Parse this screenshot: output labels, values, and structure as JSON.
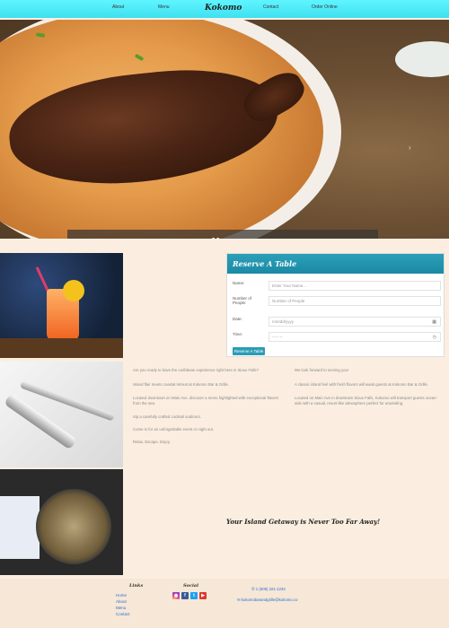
{
  "nav": {
    "about": "About",
    "menu": "Menu",
    "logo": "Kokomo",
    "contact": "Contact",
    "order": "Order Online"
  },
  "hero": {
    "caption": "Menu",
    "next_icon": "chevron-right-icon"
  },
  "reserve": {
    "title": "Reserve A Table",
    "name_label": "Name:",
    "name_placeholder": "Enter Your Name...",
    "people_label": "Number of People:",
    "people_placeholder": "Number of People",
    "date_label": "Date:",
    "date_placeholder": "mm/dd/yyyy",
    "time_label": "Time:",
    "time_placeholder": "--:-- --",
    "button": "Reserve A Table"
  },
  "content": {
    "left_p1": "Are you ready to have the caribbean experience right here in Sioux Falls?",
    "left_p2": "Island flair meets coastal retreat at Kokomo Bar & Grille.",
    "left_p3": "Located downtown on Main Ave, discover a menu highlighted with exceptional flavors from the sea.",
    "left_p4": "Sip a carefully crafted cocktail outdoors.",
    "left_p5": "Come in for an unforgettable event or night out.",
    "left_p6": "Relax. Escape. Enjoy.",
    "right_p1": "We look forward to serving you!",
    "right_p2": "A classic island feel with fresh flavors will await guests at Kokomo Bar & Grille.",
    "right_p3": "Located on Main Ave in downtown Sioux Falls, Kokomo will transport guests ocean-side with a casual, resort-like atmosphere perfect for unwinding.",
    "tagline": "Your Island Getaway is Never Too Far Away!"
  },
  "footer": {
    "links_heading": "Links",
    "links": [
      "Home",
      "About",
      "Menu",
      "Contact"
    ],
    "social_heading": "Social",
    "phone": "✆ 1 (605) 321-1234",
    "email": "✉ kokomobarandgrille@kokomo.co"
  },
  "colors": {
    "nav": "#4feaf6",
    "accent": "#1e8fa8",
    "background": "#fbeee0"
  }
}
